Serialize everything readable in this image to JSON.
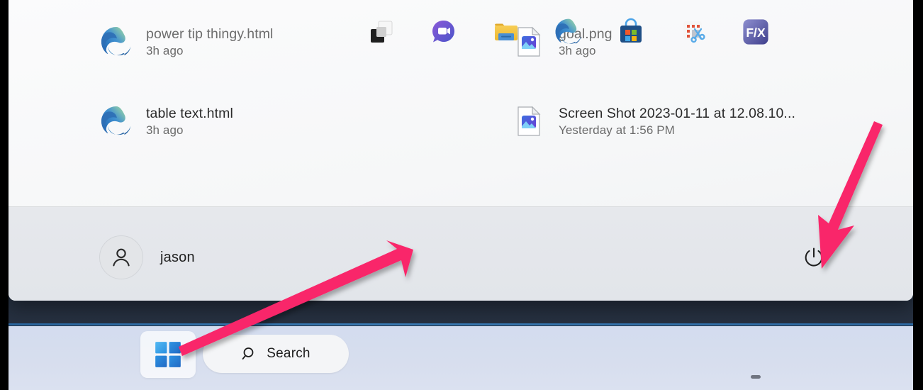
{
  "start_menu": {
    "recommended": [
      {
        "name": "power tip thingy.html",
        "time": "3h ago",
        "icon": "edge-icon",
        "dim": true
      },
      {
        "name": "goal.png",
        "time": "3h ago",
        "icon": "image-file-icon",
        "dim": true
      },
      {
        "name": "table text.html",
        "time": "3h ago",
        "icon": "edge-icon",
        "dim": false
      },
      {
        "name": "Screen Shot 2023-01-11 at 12.08.10...",
        "time": "Yesterday at 1:56 PM",
        "icon": "image-file-icon",
        "dim": false
      }
    ],
    "account": {
      "username": "jason",
      "avatar_icon": "person-icon"
    },
    "power": {
      "icon": "power-icon"
    }
  },
  "taskbar": {
    "start_button": {
      "icon": "windows-logo-icon"
    },
    "search": {
      "label": "Search",
      "icon": "search-icon"
    },
    "apps": [
      {
        "name": "Task View",
        "icon": "task-view-icon",
        "running": false
      },
      {
        "name": "Chat",
        "icon": "chat-icon",
        "running": false
      },
      {
        "name": "File Explorer",
        "icon": "folder-icon",
        "running": false
      },
      {
        "name": "Microsoft Edge",
        "icon": "edge-icon",
        "running": false
      },
      {
        "name": "Microsoft Store",
        "icon": "store-icon",
        "running": false
      },
      {
        "name": "Snipping Tool",
        "icon": "snipping-tool-icon",
        "running": false
      },
      {
        "name": "F/X",
        "icon": "fx-icon",
        "running": true,
        "label": "F/X"
      }
    ]
  },
  "annotations": {
    "arrow_to_power": {
      "color": "#f9286a"
    },
    "arrow_to_start": {
      "color": "#f9286a"
    }
  },
  "colors": {
    "menu_background": "#f7f8f9",
    "footer_background": "#e4e7eb",
    "taskbar_background": "#d5ddf0",
    "accent_pink": "#f9286a",
    "text_primary": "#2b2b2b",
    "text_secondary": "#6b6b6b"
  }
}
